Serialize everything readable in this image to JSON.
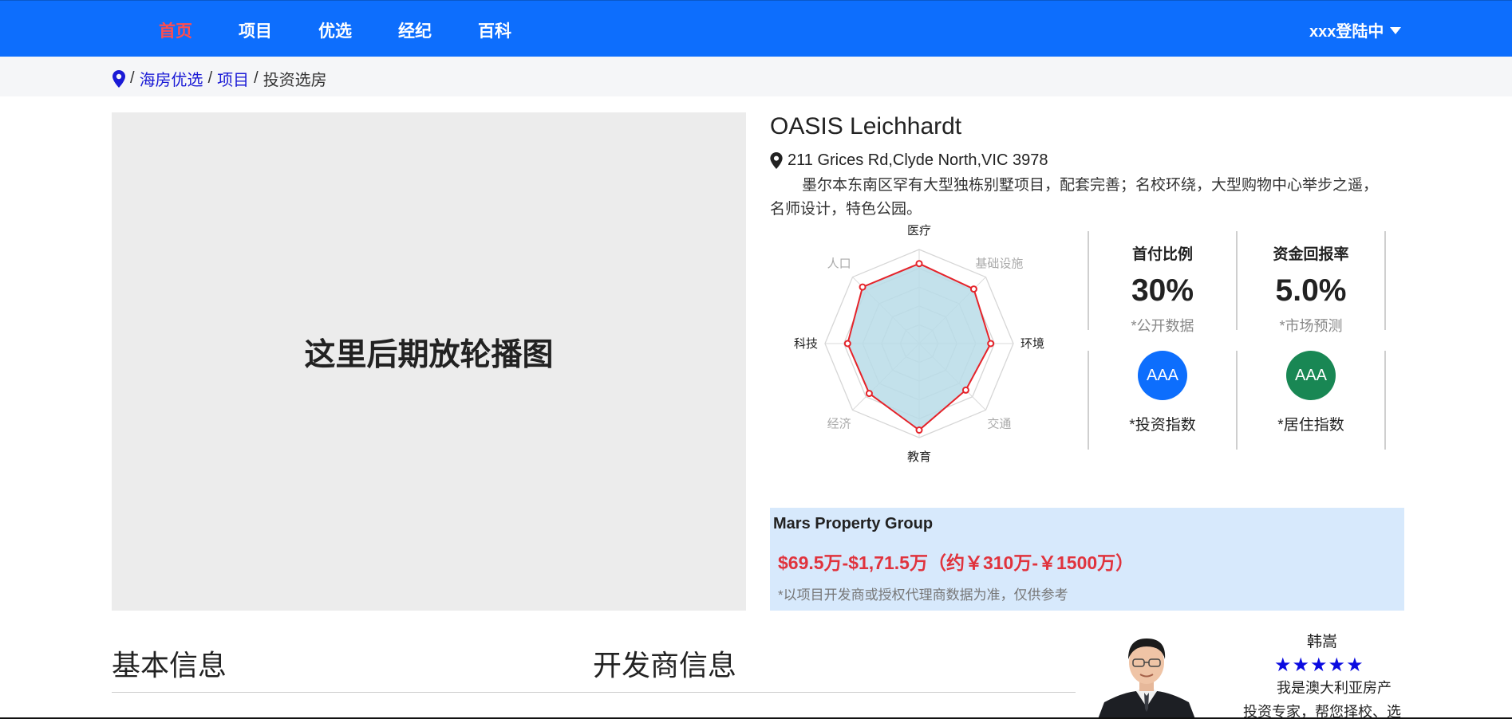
{
  "nav": {
    "items": [
      {
        "label": "首页",
        "active": true
      },
      {
        "label": "项目"
      },
      {
        "label": "优选"
      },
      {
        "label": "经纪"
      },
      {
        "label": "百科"
      }
    ],
    "user_label": "xxx登陆中",
    "user_icon": "caret-down-icon"
  },
  "breadcrumb": {
    "icon": "map-pin-icon",
    "sep": "/",
    "items": [
      "海房优选",
      "项目",
      "投资选房"
    ]
  },
  "carousel": {
    "placeholder": "这里后期放轮播图"
  },
  "project": {
    "title": "OASIS Leichhardt",
    "address": "211 Grices Rd,Clyde North,VIC 3978",
    "description": "墨尔本东南区罕有大型独栋别墅项目，配套完善；名校环绕，大型购物中心举步之遥，名师设计，特色公园。"
  },
  "chart_data": {
    "type": "radar",
    "categories": [
      "医疗",
      "基础设施",
      "环境",
      "交通",
      "教育",
      "经济",
      "科技",
      "人口"
    ],
    "values": [
      8.5,
      8.2,
      7.6,
      7.0,
      9.2,
      7.5,
      7.6,
      8.5
    ],
    "max": 10,
    "rings": 5,
    "label_colors": [
      "#222222",
      "#aaaaaa",
      "#222222",
      "#aaaaaa",
      "#222222",
      "#aaaaaa",
      "#222222",
      "#aaaaaa"
    ],
    "area_color": "#b9dce7",
    "line_color": "#e5232a"
  },
  "stats": {
    "down_payment": {
      "label": "首付比例",
      "value": "30%",
      "note": "*公开数据"
    },
    "roi": {
      "label": "资金回报率",
      "value": "5.0%",
      "note": "*市场预测"
    },
    "invest_index": {
      "rating": "AAA",
      "note": "*投资指数",
      "color": "#0d6efd"
    },
    "living_index": {
      "rating": "AAA",
      "note": "*居住指数",
      "color": "#198754"
    }
  },
  "developer": {
    "name": "Mars Property Group",
    "price": "$69.5万-$1,71.5万（约￥310万-￥1500万）",
    "note": "*以项目开发商或授权代理商数据为准，仅供参考"
  },
  "sections": {
    "basic": "基本信息",
    "developer": "开发商信息"
  },
  "agent": {
    "name": "韩嵩",
    "stars": "★★★★★",
    "rating": 5,
    "bio": "我是澳大利亚房产投资专家，帮您择校、选房"
  }
}
